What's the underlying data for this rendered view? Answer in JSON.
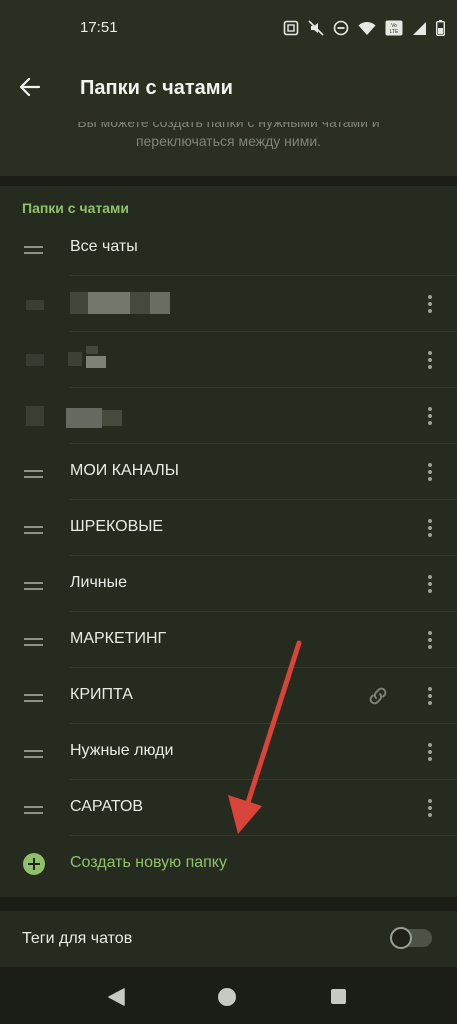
{
  "status_bar": {
    "time": "17:51",
    "icons": [
      "nfc-icon",
      "mute-icon",
      "dnd-icon",
      "wifi-icon",
      "volte-icon",
      "signal-icon",
      "battery-icon"
    ]
  },
  "app_bar": {
    "back_icon": "arrow-left-icon",
    "title": "Папки с чатами"
  },
  "intro": {
    "line1": "Вы можете создать папки с нужными чатами и",
    "line2": "переключаться между ними."
  },
  "folders": {
    "header": "Папки с чатами",
    "items": [
      {
        "label": "Все чаты",
        "has_menu": false
      },
      {
        "label": "",
        "redacted": true,
        "has_menu": true
      },
      {
        "label": "",
        "redacted": true,
        "has_menu": true
      },
      {
        "label": "",
        "redacted": true,
        "has_menu": true
      },
      {
        "label": "МОИ КАНАЛЫ",
        "has_menu": true
      },
      {
        "label": "ШРЕКОВЫЕ",
        "has_menu": true
      },
      {
        "label": "Личные",
        "has_menu": true
      },
      {
        "label": "МАРКЕТИНГ",
        "has_menu": true
      },
      {
        "label": "КРИПТА",
        "has_menu": true,
        "shared_link_icon": true
      },
      {
        "label": "Нужные люди",
        "has_menu": true
      },
      {
        "label": "САРАТОВ",
        "has_menu": true
      }
    ],
    "create_label": "Создать новую папку"
  },
  "tags": {
    "label": "Теги для чатов",
    "enabled": false
  },
  "colors": {
    "accent": "#8fc16a",
    "background": "#202419",
    "card": "#262b20",
    "annotation_arrow": "#d9443a"
  },
  "nav_bar": {
    "icons": [
      "nav-back-icon",
      "nav-home-icon",
      "nav-recents-icon"
    ]
  }
}
